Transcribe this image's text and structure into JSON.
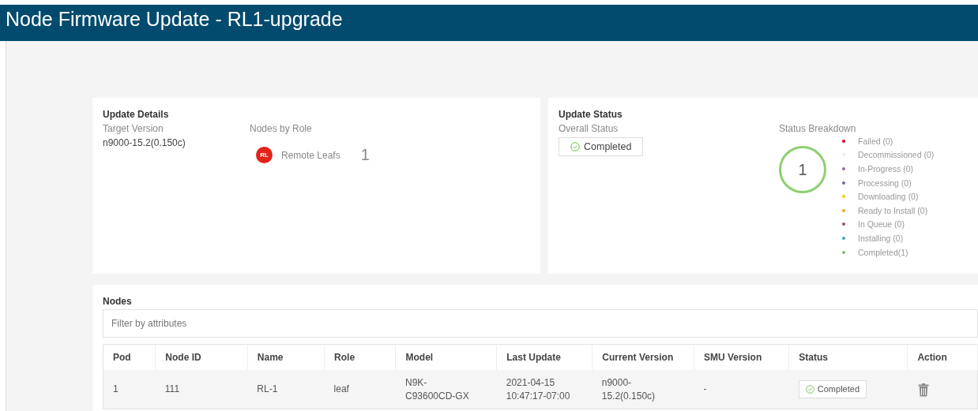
{
  "window": {
    "title": "Node Firmware Update - RL1-upgrade"
  },
  "update_details": {
    "heading": "Update Details",
    "target_version_label": "Target Version",
    "target_version": "n9000-15.2(0.150c)",
    "nodes_by_role_label": "Nodes by Role",
    "roles": [
      {
        "badge": "RL",
        "name": "Remote Leafs",
        "count": "1",
        "color": "#e2231a"
      }
    ]
  },
  "update_status": {
    "heading": "Update Status",
    "overall_label": "Overall Status",
    "overall": "Completed",
    "breakdown_label": "Status Breakdown",
    "total": "1",
    "legend": [
      {
        "label": "Failed (0)",
        "color": "#d0021b"
      },
      {
        "label": "Decommissioned (0)",
        "color": "#fbe3e3"
      },
      {
        "label": "In-Progress (0)",
        "color": "#8e6cb5"
      },
      {
        "label": "Processing (0)",
        "color": "#7b61a8"
      },
      {
        "label": "Downloading (0)",
        "color": "#fbc500"
      },
      {
        "label": "Ready to Install (0)",
        "color": "#f5a623"
      },
      {
        "label": "In Queue (0)",
        "color": "#a84b4b"
      },
      {
        "label": "Installing (0)",
        "color": "#4a9fd8"
      },
      {
        "label": "Completed(1)",
        "color": "#7cc35c"
      }
    ]
  },
  "nodes": {
    "heading": "Nodes",
    "filter": {
      "placeholder": "Filter by attributes"
    },
    "columns": [
      "Pod",
      "Node ID",
      "Name",
      "Role",
      "Model",
      "Last Update",
      "Current Version",
      "SMU Version",
      "Status",
      "Action"
    ],
    "rows": [
      {
        "pod": "1",
        "node_id": "111",
        "name": "RL-1",
        "role": "leaf",
        "model": [
          "N9K-",
          "C93600CD-GX"
        ],
        "last_update": [
          "2021-04-15",
          "10:47:17-07:00"
        ],
        "current_version": [
          "n9000-",
          "15.2(0.150c)"
        ],
        "smu_version": "-",
        "status": "Completed"
      }
    ]
  }
}
